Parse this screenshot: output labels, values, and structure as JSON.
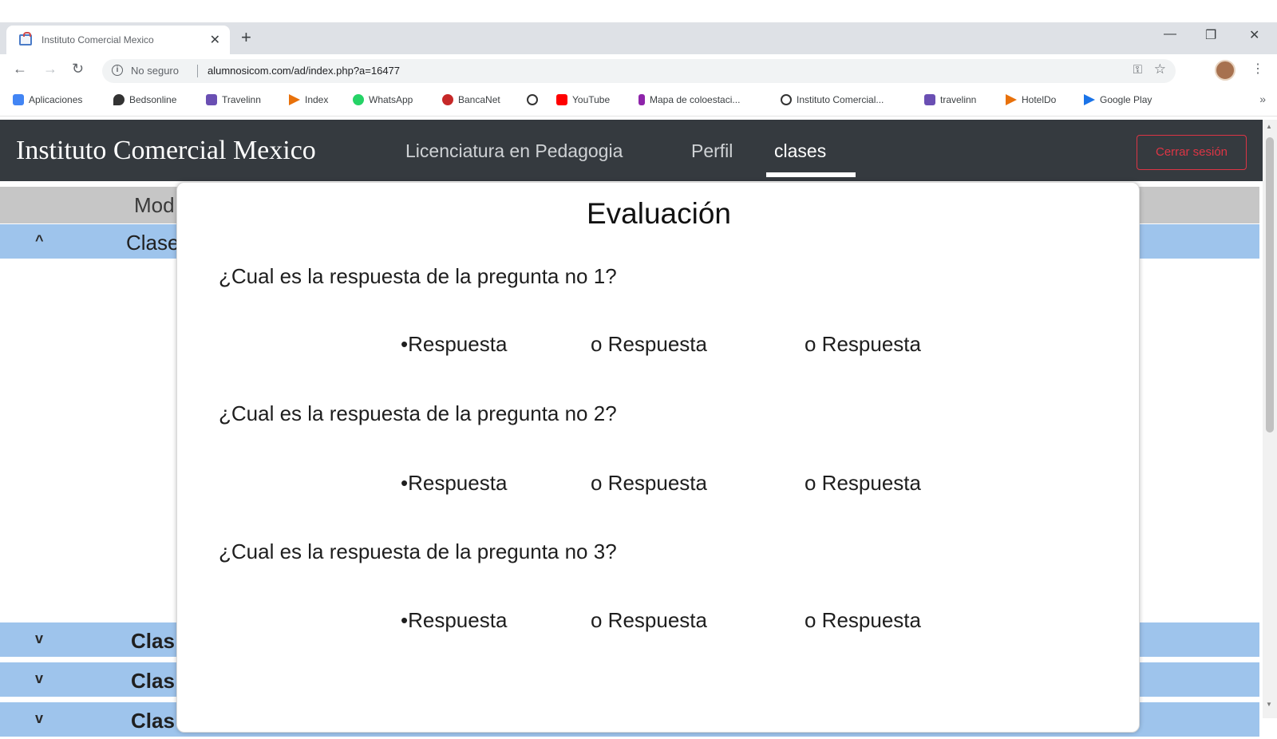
{
  "browser": {
    "tab_title": "Instituto Comercial Mexico",
    "tab_close": "✕",
    "new_tab": "+",
    "window_controls": {
      "minimize": "—",
      "restore": "❐",
      "close": "✕"
    },
    "nav": {
      "back": "←",
      "forward": "→",
      "reload": "↻"
    },
    "security_label": "No seguro",
    "url": "alumnosicom.com/ad/index.php?a=16477",
    "bookmarks": [
      {
        "label": "Aplicaciones",
        "color": "#4285f4"
      },
      {
        "label": "Bedsonline",
        "color": "#333333"
      },
      {
        "label": "Travelinn",
        "color": "#6a4fb3"
      },
      {
        "label": "Index",
        "color": "#e8710a"
      },
      {
        "label": "WhatsApp",
        "color": "#25d366"
      },
      {
        "label": "BancaNet",
        "color": "#c62828"
      },
      {
        "label": "",
        "color": "#333333"
      },
      {
        "label": "YouTube",
        "color": "#ff0000"
      },
      {
        "label": "Mapa de coloestaci...",
        "color": "#8e24aa"
      },
      {
        "label": "Instituto Comercial...",
        "color": "#333333"
      },
      {
        "label": "travelinn",
        "color": "#6a4fb3"
      },
      {
        "label": "HotelDo",
        "color": "#e8710a"
      },
      {
        "label": "Google Play",
        "color": "#1a73e8"
      }
    ],
    "bookmarks_more": "»"
  },
  "site": {
    "brand": "Instituto Comercial Mexico",
    "nav_links": [
      "Licenciatura en Pedagogia",
      "Perfil",
      "clases"
    ],
    "active_link": "clases",
    "logout_label": "Cerrar sesión"
  },
  "accordion": {
    "header": "Mod",
    "rows": [
      {
        "chevron": "^",
        "label": "Clase"
      },
      {
        "chevron": "v",
        "label": "Clas"
      },
      {
        "chevron": "v",
        "label": "Clas"
      },
      {
        "chevron": "v",
        "label": "Clas"
      }
    ]
  },
  "evaluation": {
    "title": "Evaluación",
    "questions": [
      {
        "text": "¿Cual es la respuesta de la pregunta no 1?",
        "options": [
          "•Respuesta",
          "o Respuesta",
          "o Respuesta"
        ]
      },
      {
        "text": "¿Cual es la respuesta de la pregunta no 2?",
        "options": [
          "•Respuesta",
          "o Respuesta",
          "o Respuesta"
        ]
      },
      {
        "text": "¿Cual es la respuesta de la pregunta no 3?",
        "options": [
          "•Respuesta",
          "o Respuesta",
          "o Respuesta"
        ]
      }
    ]
  }
}
